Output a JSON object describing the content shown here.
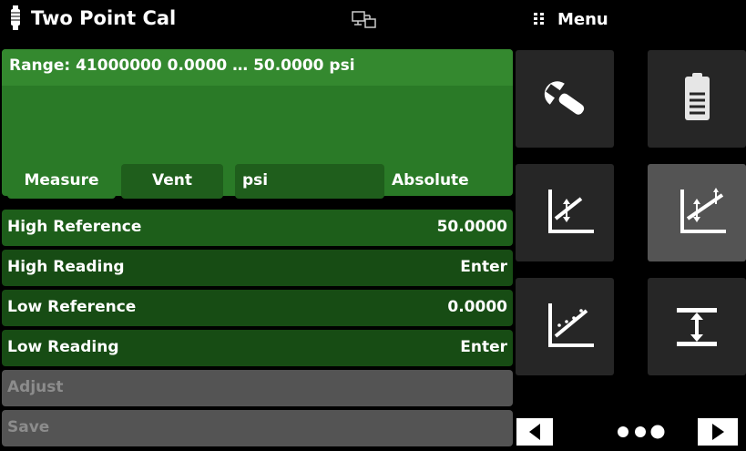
{
  "header": {
    "title": "Two Point Cal",
    "menu_label": "Menu",
    "title_icon": "transducer-icon",
    "connection_icon": "remote-connection-icon"
  },
  "range": {
    "text": "Range: 41000000   0.0000 … 50.0000 psi"
  },
  "mode": {
    "measure": "Measure",
    "vent": "Vent",
    "unit": "psi",
    "pressure_type": "Absolute"
  },
  "rows": [
    {
      "label": "High Reference",
      "value": "50.0000"
    },
    {
      "label": "High Reading",
      "value": "Enter"
    },
    {
      "label": "Low Reference",
      "value": "0.0000"
    },
    {
      "label": "Low Reading",
      "value": "Enter"
    }
  ],
  "actions": {
    "adjust": "Adjust",
    "save": "Save"
  },
  "menu_tiles": [
    {
      "icon": "wrench-icon"
    },
    {
      "icon": "document-icon"
    },
    {
      "icon": "one-point-cal-icon"
    },
    {
      "icon": "two-point-cal-icon",
      "selected": true
    },
    {
      "icon": "linearization-cal-icon"
    },
    {
      "icon": "range-limit-icon"
    }
  ],
  "pager": {
    "current_page": 3,
    "total_pages": 3
  },
  "colors": {
    "panel_green": "#2a7a27",
    "row_green": "#174c14",
    "disabled_gray": "#545454",
    "tile_dark": "#262626"
  }
}
